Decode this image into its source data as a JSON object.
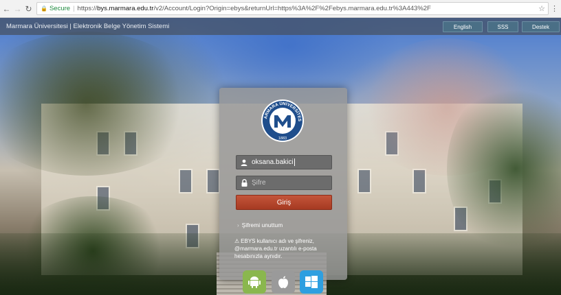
{
  "browser": {
    "secure_label": "Secure",
    "url_prefix": "https://",
    "url_host": "bys.marmara.edu.tr",
    "url_path": "/v2/Account/Login?Origin=ebys&returnUrl=https%3A%2F%2Febys.marmara.edu.tr%3A443%2F"
  },
  "header": {
    "title": "Marmara Üniversitesi | Elektronik Belge Yönetim Sistemi",
    "buttons": {
      "english": "English",
      "sss": "SSS",
      "destek": "Destek"
    }
  },
  "login": {
    "logo_text": "MARMARA ÜNİVERSİTESİ",
    "logo_year": "1883",
    "username_value": "oksana.bakici",
    "password_placeholder": "Şifre",
    "submit_label": "Giriş",
    "forgot_label": "Şifremi unuttum",
    "info_text": "EBYS kullanıcı adı ve şifreniz, @marmara.edu.tr uzantılı e-posta hesabınızla aynıdır."
  },
  "colors": {
    "login_button": "#b0412a",
    "top_button": "#4a6f86",
    "secure": "#1d8a3e"
  },
  "apps": [
    {
      "icon": "android-icon"
    },
    {
      "icon": "apple-icon"
    },
    {
      "icon": "windows-icon"
    }
  ]
}
